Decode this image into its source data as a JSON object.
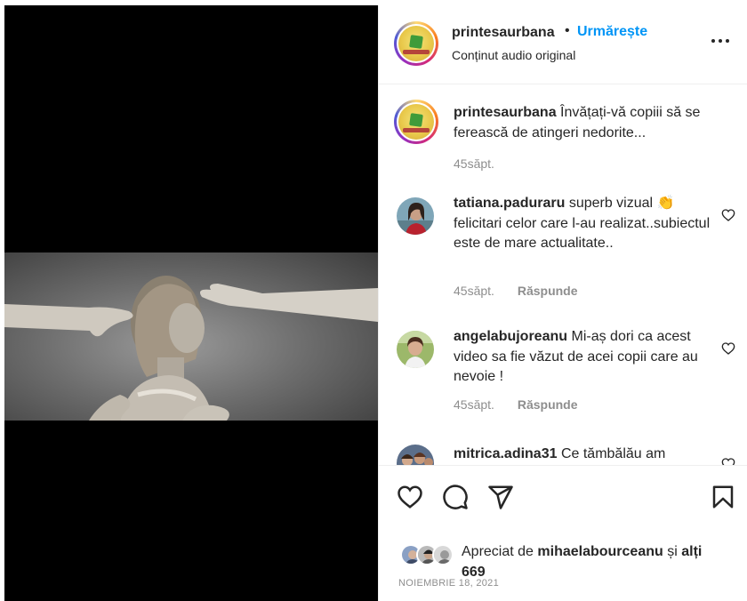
{
  "post": {
    "username": "printesaurbana",
    "separator": "•",
    "follow_label": "Urmărește",
    "audio_label": "Conținut audio original"
  },
  "caption": {
    "username": "printesaurbana",
    "text": "Învățați-vă copiii să se ferească de atingeri nedorite...",
    "time": "45săpt."
  },
  "comments": [
    {
      "username": "tatiana.paduraru",
      "text": "superb vizual 👏 felicitari celor care l-au realizat..subiectul este de mare actualitate..",
      "time": "45săpt.",
      "reply_label": "Răspunde"
    },
    {
      "username": "angelabujoreanu",
      "text": "Mi-aș dori ca acest video sa fie văzut de acei copii care au nevoie !",
      "time": "45săpt.",
      "reply_label": "Răspunde"
    },
    {
      "username": "mitrica.adina31",
      "text": "Ce tămbălău am"
    }
  ],
  "likes": {
    "prefix": "Apreciat de",
    "user": "mihaelabourceanu",
    "conj": "și",
    "others": "alți 669"
  },
  "date": "NOIEMBRIE 18, 2021",
  "icons": [
    "more-icon",
    "heart-icon",
    "comment-icon",
    "share-icon",
    "bookmark-icon"
  ],
  "colors": {
    "accent": "#0095f6",
    "text": "#262626",
    "muted": "#8e8e8e",
    "media_bg": "#000000"
  }
}
